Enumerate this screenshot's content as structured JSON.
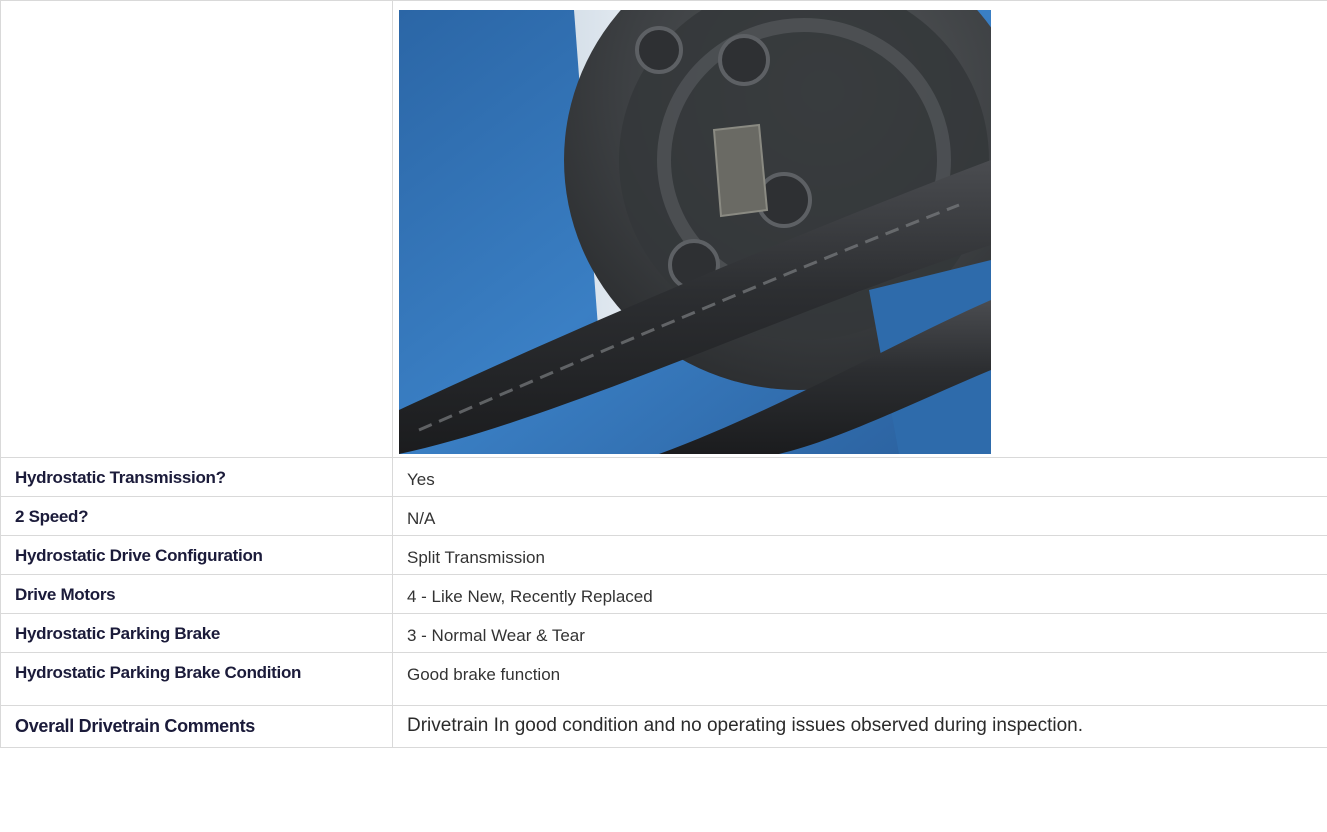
{
  "photo": {
    "name": "drive-motor-photo",
    "colors": {
      "frame_blue": "#2f6fb2",
      "motor_dark": "#3b3d3f",
      "hose_dark": "#2c2d30",
      "highlight": "#e8ecef"
    }
  },
  "rows": [
    {
      "label": "Hydrostatic Transmission?",
      "value": "Yes"
    },
    {
      "label": "2 Speed?",
      "value": "N/A"
    },
    {
      "label": "Hydrostatic Drive Configuration",
      "value": "Split Transmission"
    },
    {
      "label": "Drive Motors",
      "value": "4 - Like New, Recently Replaced"
    },
    {
      "label": "Hydrostatic Parking Brake",
      "value": "3 - Normal Wear & Tear"
    },
    {
      "label": "Hydrostatic Parking Brake Condition",
      "value": "Good brake function"
    },
    {
      "label": "Overall Drivetrain Comments",
      "value": "Drivetrain In good condition and no operating issues observed during inspection."
    }
  ]
}
